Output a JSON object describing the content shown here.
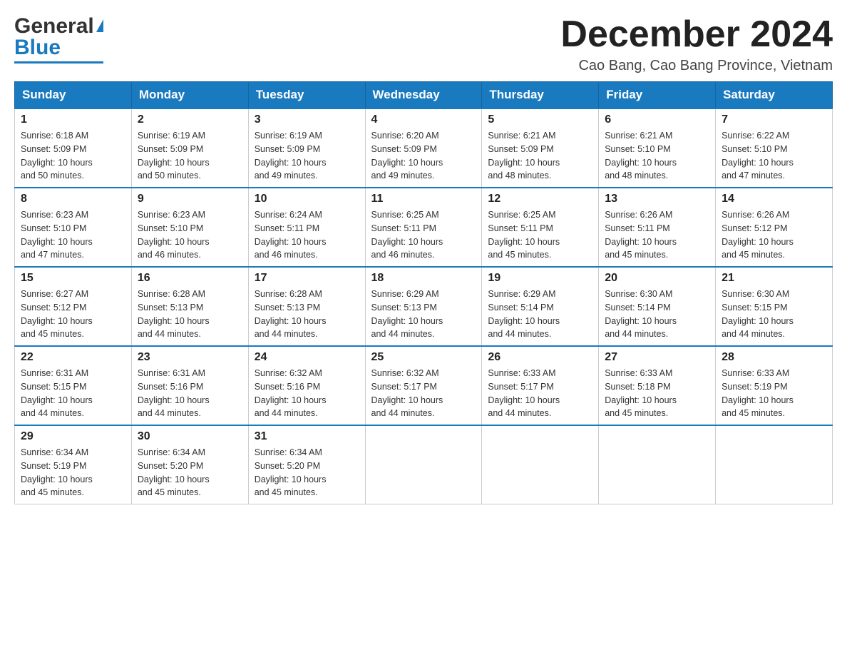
{
  "header": {
    "logo_text_general": "General",
    "logo_text_blue": "Blue",
    "title": "December 2024",
    "subtitle": "Cao Bang, Cao Bang Province, Vietnam"
  },
  "days_of_week": [
    "Sunday",
    "Monday",
    "Tuesday",
    "Wednesday",
    "Thursday",
    "Friday",
    "Saturday"
  ],
  "weeks": [
    [
      {
        "day": "1",
        "sunrise": "6:18 AM",
        "sunset": "5:09 PM",
        "daylight": "10 hours and 50 minutes."
      },
      {
        "day": "2",
        "sunrise": "6:19 AM",
        "sunset": "5:09 PM",
        "daylight": "10 hours and 50 minutes."
      },
      {
        "day": "3",
        "sunrise": "6:19 AM",
        "sunset": "5:09 PM",
        "daylight": "10 hours and 49 minutes."
      },
      {
        "day": "4",
        "sunrise": "6:20 AM",
        "sunset": "5:09 PM",
        "daylight": "10 hours and 49 minutes."
      },
      {
        "day": "5",
        "sunrise": "6:21 AM",
        "sunset": "5:09 PM",
        "daylight": "10 hours and 48 minutes."
      },
      {
        "day": "6",
        "sunrise": "6:21 AM",
        "sunset": "5:10 PM",
        "daylight": "10 hours and 48 minutes."
      },
      {
        "day": "7",
        "sunrise": "6:22 AM",
        "sunset": "5:10 PM",
        "daylight": "10 hours and 47 minutes."
      }
    ],
    [
      {
        "day": "8",
        "sunrise": "6:23 AM",
        "sunset": "5:10 PM",
        "daylight": "10 hours and 47 minutes."
      },
      {
        "day": "9",
        "sunrise": "6:23 AM",
        "sunset": "5:10 PM",
        "daylight": "10 hours and 46 minutes."
      },
      {
        "day": "10",
        "sunrise": "6:24 AM",
        "sunset": "5:11 PM",
        "daylight": "10 hours and 46 minutes."
      },
      {
        "day": "11",
        "sunrise": "6:25 AM",
        "sunset": "5:11 PM",
        "daylight": "10 hours and 46 minutes."
      },
      {
        "day": "12",
        "sunrise": "6:25 AM",
        "sunset": "5:11 PM",
        "daylight": "10 hours and 45 minutes."
      },
      {
        "day": "13",
        "sunrise": "6:26 AM",
        "sunset": "5:11 PM",
        "daylight": "10 hours and 45 minutes."
      },
      {
        "day": "14",
        "sunrise": "6:26 AM",
        "sunset": "5:12 PM",
        "daylight": "10 hours and 45 minutes."
      }
    ],
    [
      {
        "day": "15",
        "sunrise": "6:27 AM",
        "sunset": "5:12 PM",
        "daylight": "10 hours and 45 minutes."
      },
      {
        "day": "16",
        "sunrise": "6:28 AM",
        "sunset": "5:13 PM",
        "daylight": "10 hours and 44 minutes."
      },
      {
        "day": "17",
        "sunrise": "6:28 AM",
        "sunset": "5:13 PM",
        "daylight": "10 hours and 44 minutes."
      },
      {
        "day": "18",
        "sunrise": "6:29 AM",
        "sunset": "5:13 PM",
        "daylight": "10 hours and 44 minutes."
      },
      {
        "day": "19",
        "sunrise": "6:29 AM",
        "sunset": "5:14 PM",
        "daylight": "10 hours and 44 minutes."
      },
      {
        "day": "20",
        "sunrise": "6:30 AM",
        "sunset": "5:14 PM",
        "daylight": "10 hours and 44 minutes."
      },
      {
        "day": "21",
        "sunrise": "6:30 AM",
        "sunset": "5:15 PM",
        "daylight": "10 hours and 44 minutes."
      }
    ],
    [
      {
        "day": "22",
        "sunrise": "6:31 AM",
        "sunset": "5:15 PM",
        "daylight": "10 hours and 44 minutes."
      },
      {
        "day": "23",
        "sunrise": "6:31 AM",
        "sunset": "5:16 PM",
        "daylight": "10 hours and 44 minutes."
      },
      {
        "day": "24",
        "sunrise": "6:32 AM",
        "sunset": "5:16 PM",
        "daylight": "10 hours and 44 minutes."
      },
      {
        "day": "25",
        "sunrise": "6:32 AM",
        "sunset": "5:17 PM",
        "daylight": "10 hours and 44 minutes."
      },
      {
        "day": "26",
        "sunrise": "6:33 AM",
        "sunset": "5:17 PM",
        "daylight": "10 hours and 44 minutes."
      },
      {
        "day": "27",
        "sunrise": "6:33 AM",
        "sunset": "5:18 PM",
        "daylight": "10 hours and 45 minutes."
      },
      {
        "day": "28",
        "sunrise": "6:33 AM",
        "sunset": "5:19 PM",
        "daylight": "10 hours and 45 minutes."
      }
    ],
    [
      {
        "day": "29",
        "sunrise": "6:34 AM",
        "sunset": "5:19 PM",
        "daylight": "10 hours and 45 minutes."
      },
      {
        "day": "30",
        "sunrise": "6:34 AM",
        "sunset": "5:20 PM",
        "daylight": "10 hours and 45 minutes."
      },
      {
        "day": "31",
        "sunrise": "6:34 AM",
        "sunset": "5:20 PM",
        "daylight": "10 hours and 45 minutes."
      },
      null,
      null,
      null,
      null
    ]
  ],
  "labels": {
    "sunrise": "Sunrise: ",
    "sunset": "Sunset: ",
    "daylight": "Daylight: "
  }
}
